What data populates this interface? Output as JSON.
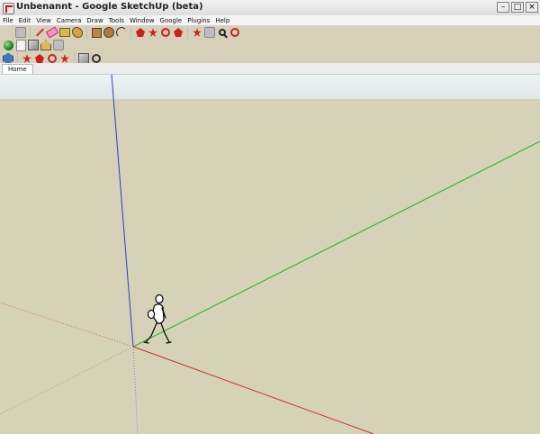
{
  "window": {
    "title": "Unbenannt - Google SketchUp (beta)"
  },
  "menu": [
    "File",
    "Edit",
    "View",
    "Camera",
    "Draw",
    "Tools",
    "Window",
    "Google",
    "Plugins",
    "Help"
  ],
  "tabs": [
    {
      "label": "Home"
    }
  ],
  "toolbar_rows": [
    [
      "select-tool",
      "component-tool",
      "pencil-tool",
      "eraser-tool",
      "tape-measure-tool",
      "paint-bucket-tool",
      "rectangle-tool",
      "circle-tool",
      "arc-tool",
      "push-pull-tool",
      "move-tool",
      "rotate-tool",
      "follow-me-tool",
      "orbit-tool",
      "pan-tool",
      "zoom-tool",
      "zoom-extents-tool"
    ],
    [
      "globe-tool",
      "document-tool",
      "cube-tool",
      "house-tool",
      "gray-tool"
    ],
    [
      "iso-view-tool",
      "top-view-tool",
      "front-view-tool",
      "right-view-tool",
      "back-view-tool",
      "left-view-tool",
      "print-tool",
      "settings-tool"
    ]
  ],
  "colors": {
    "ground": "#d6d2b8",
    "sky": "#e6ecec",
    "axis_blue": "#2a3bd6",
    "axis_green": "#1bb321",
    "axis_red": "#cc2b2b"
  }
}
